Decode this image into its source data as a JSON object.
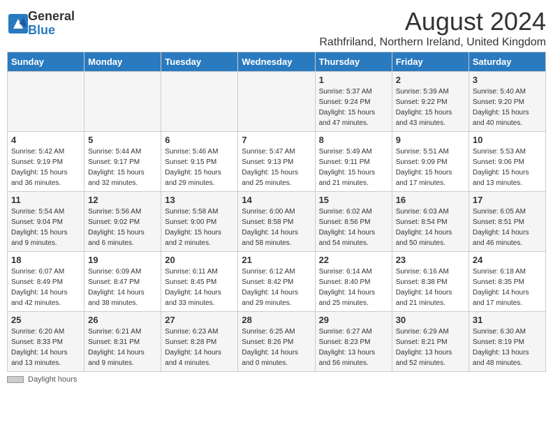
{
  "header": {
    "logo_general": "General",
    "logo_blue": "Blue",
    "month_title": "August 2024",
    "location": "Rathfriland, Northern Ireland, United Kingdom"
  },
  "calendar": {
    "days_of_week": [
      "Sunday",
      "Monday",
      "Tuesday",
      "Wednesday",
      "Thursday",
      "Friday",
      "Saturday"
    ],
    "weeks": [
      [
        {
          "day": "",
          "sunrise": "",
          "sunset": "",
          "daylight": ""
        },
        {
          "day": "",
          "sunrise": "",
          "sunset": "",
          "daylight": ""
        },
        {
          "day": "",
          "sunrise": "",
          "sunset": "",
          "daylight": ""
        },
        {
          "day": "",
          "sunrise": "",
          "sunset": "",
          "daylight": ""
        },
        {
          "day": "1",
          "sunrise": "Sunrise: 5:37 AM",
          "sunset": "Sunset: 9:24 PM",
          "daylight": "Daylight: 15 hours and 47 minutes."
        },
        {
          "day": "2",
          "sunrise": "Sunrise: 5:39 AM",
          "sunset": "Sunset: 9:22 PM",
          "daylight": "Daylight: 15 hours and 43 minutes."
        },
        {
          "day": "3",
          "sunrise": "Sunrise: 5:40 AM",
          "sunset": "Sunset: 9:20 PM",
          "daylight": "Daylight: 15 hours and 40 minutes."
        }
      ],
      [
        {
          "day": "4",
          "sunrise": "Sunrise: 5:42 AM",
          "sunset": "Sunset: 9:19 PM",
          "daylight": "Daylight: 15 hours and 36 minutes."
        },
        {
          "day": "5",
          "sunrise": "Sunrise: 5:44 AM",
          "sunset": "Sunset: 9:17 PM",
          "daylight": "Daylight: 15 hours and 32 minutes."
        },
        {
          "day": "6",
          "sunrise": "Sunrise: 5:46 AM",
          "sunset": "Sunset: 9:15 PM",
          "daylight": "Daylight: 15 hours and 29 minutes."
        },
        {
          "day": "7",
          "sunrise": "Sunrise: 5:47 AM",
          "sunset": "Sunset: 9:13 PM",
          "daylight": "Daylight: 15 hours and 25 minutes."
        },
        {
          "day": "8",
          "sunrise": "Sunrise: 5:49 AM",
          "sunset": "Sunset: 9:11 PM",
          "daylight": "Daylight: 15 hours and 21 minutes."
        },
        {
          "day": "9",
          "sunrise": "Sunrise: 5:51 AM",
          "sunset": "Sunset: 9:09 PM",
          "daylight": "Daylight: 15 hours and 17 minutes."
        },
        {
          "day": "10",
          "sunrise": "Sunrise: 5:53 AM",
          "sunset": "Sunset: 9:06 PM",
          "daylight": "Daylight: 15 hours and 13 minutes."
        }
      ],
      [
        {
          "day": "11",
          "sunrise": "Sunrise: 5:54 AM",
          "sunset": "Sunset: 9:04 PM",
          "daylight": "Daylight: 15 hours and 9 minutes."
        },
        {
          "day": "12",
          "sunrise": "Sunrise: 5:56 AM",
          "sunset": "Sunset: 9:02 PM",
          "daylight": "Daylight: 15 hours and 6 minutes."
        },
        {
          "day": "13",
          "sunrise": "Sunrise: 5:58 AM",
          "sunset": "Sunset: 9:00 PM",
          "daylight": "Daylight: 15 hours and 2 minutes."
        },
        {
          "day": "14",
          "sunrise": "Sunrise: 6:00 AM",
          "sunset": "Sunset: 8:58 PM",
          "daylight": "Daylight: 14 hours and 58 minutes."
        },
        {
          "day": "15",
          "sunrise": "Sunrise: 6:02 AM",
          "sunset": "Sunset: 8:56 PM",
          "daylight": "Daylight: 14 hours and 54 minutes."
        },
        {
          "day": "16",
          "sunrise": "Sunrise: 6:03 AM",
          "sunset": "Sunset: 8:54 PM",
          "daylight": "Daylight: 14 hours and 50 minutes."
        },
        {
          "day": "17",
          "sunrise": "Sunrise: 6:05 AM",
          "sunset": "Sunset: 8:51 PM",
          "daylight": "Daylight: 14 hours and 46 minutes."
        }
      ],
      [
        {
          "day": "18",
          "sunrise": "Sunrise: 6:07 AM",
          "sunset": "Sunset: 8:49 PM",
          "daylight": "Daylight: 14 hours and 42 minutes."
        },
        {
          "day": "19",
          "sunrise": "Sunrise: 6:09 AM",
          "sunset": "Sunset: 8:47 PM",
          "daylight": "Daylight: 14 hours and 38 minutes."
        },
        {
          "day": "20",
          "sunrise": "Sunrise: 6:11 AM",
          "sunset": "Sunset: 8:45 PM",
          "daylight": "Daylight: 14 hours and 33 minutes."
        },
        {
          "day": "21",
          "sunrise": "Sunrise: 6:12 AM",
          "sunset": "Sunset: 8:42 PM",
          "daylight": "Daylight: 14 hours and 29 minutes."
        },
        {
          "day": "22",
          "sunrise": "Sunrise: 6:14 AM",
          "sunset": "Sunset: 8:40 PM",
          "daylight": "Daylight: 14 hours and 25 minutes."
        },
        {
          "day": "23",
          "sunrise": "Sunrise: 6:16 AM",
          "sunset": "Sunset: 8:38 PM",
          "daylight": "Daylight: 14 hours and 21 minutes."
        },
        {
          "day": "24",
          "sunrise": "Sunrise: 6:18 AM",
          "sunset": "Sunset: 8:35 PM",
          "daylight": "Daylight: 14 hours and 17 minutes."
        }
      ],
      [
        {
          "day": "25",
          "sunrise": "Sunrise: 6:20 AM",
          "sunset": "Sunset: 8:33 PM",
          "daylight": "Daylight: 14 hours and 13 minutes."
        },
        {
          "day": "26",
          "sunrise": "Sunrise: 6:21 AM",
          "sunset": "Sunset: 8:31 PM",
          "daylight": "Daylight: 14 hours and 9 minutes."
        },
        {
          "day": "27",
          "sunrise": "Sunrise: 6:23 AM",
          "sunset": "Sunset: 8:28 PM",
          "daylight": "Daylight: 14 hours and 4 minutes."
        },
        {
          "day": "28",
          "sunrise": "Sunrise: 6:25 AM",
          "sunset": "Sunset: 8:26 PM",
          "daylight": "Daylight: 14 hours and 0 minutes."
        },
        {
          "day": "29",
          "sunrise": "Sunrise: 6:27 AM",
          "sunset": "Sunset: 8:23 PM",
          "daylight": "Daylight: 13 hours and 56 minutes."
        },
        {
          "day": "30",
          "sunrise": "Sunrise: 6:29 AM",
          "sunset": "Sunset: 8:21 PM",
          "daylight": "Daylight: 13 hours and 52 minutes."
        },
        {
          "day": "31",
          "sunrise": "Sunrise: 6:30 AM",
          "sunset": "Sunset: 8:19 PM",
          "daylight": "Daylight: 13 hours and 48 minutes."
        }
      ]
    ]
  },
  "footer": {
    "daylight_hours_label": "Daylight hours"
  }
}
